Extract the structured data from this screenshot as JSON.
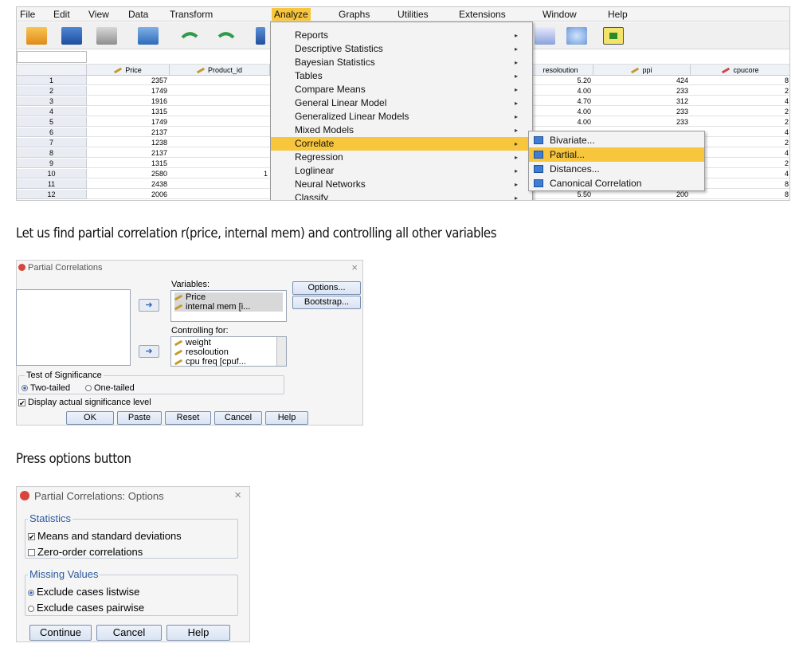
{
  "menubar": [
    "File",
    "Edit",
    "View",
    "Data",
    "Transform",
    "Analyze",
    "Graphs",
    "Utilities",
    "Extensions",
    "Window",
    "Help"
  ],
  "columns": [
    {
      "label": "Price",
      "icon": "ruler-icon"
    },
    {
      "label": "Product_id",
      "icon": "ruler-icon"
    },
    {
      "label": "resoloution",
      "icon": "ruler-icon"
    },
    {
      "label": "ppi",
      "icon": "ruler-icon"
    },
    {
      "label": "cpucore",
      "icon": "nominal-icon"
    }
  ],
  "rows": [
    {
      "n": "1",
      "price": "2357",
      "pid": "",
      "res": "5.20",
      "ppi": "424",
      "core": "8"
    },
    {
      "n": "2",
      "price": "1749",
      "pid": "",
      "res": "4.00",
      "ppi": "233",
      "core": "2"
    },
    {
      "n": "3",
      "price": "1916",
      "pid": "",
      "res": "4.70",
      "ppi": "312",
      "core": "4"
    },
    {
      "n": "4",
      "price": "1315",
      "pid": "",
      "res": "4.00",
      "ppi": "233",
      "core": "2"
    },
    {
      "n": "5",
      "price": "1749",
      "pid": "",
      "res": "4.00",
      "ppi": "233",
      "core": "2"
    },
    {
      "n": "6",
      "price": "2137",
      "pid": "",
      "res": "",
      "ppi": "",
      "core": "4"
    },
    {
      "n": "7",
      "price": "1238",
      "pid": "",
      "res": "",
      "ppi": "",
      "core": "2"
    },
    {
      "n": "8",
      "price": "2137",
      "pid": "",
      "res": "",
      "ppi": "",
      "core": "4"
    },
    {
      "n": "9",
      "price": "1315",
      "pid": "",
      "res": "",
      "ppi": "",
      "core": "2"
    },
    {
      "n": "10",
      "price": "2580",
      "pid": "1",
      "res": "",
      "ppi": "",
      "core": "4"
    },
    {
      "n": "11",
      "price": "2438",
      "pid": "",
      "res": "",
      "ppi": "",
      "core": "8"
    },
    {
      "n": "12",
      "price": "2006",
      "pid": "",
      "res": "5.50",
      "ppi": "200",
      "core": "8"
    }
  ],
  "analyze_menu": [
    "Reports",
    "Descriptive Statistics",
    "Bayesian Statistics",
    "Tables",
    "Compare Means",
    "General Linear Model",
    "Generalized Linear Models",
    "Mixed Models",
    "Correlate",
    "Regression",
    "Loglinear",
    "Neural Networks",
    "Classify"
  ],
  "correlate_submenu": [
    "Bivariate...",
    "Partial...",
    "Distances...",
    "Canonical Correlation"
  ],
  "instructions": {
    "step1": "Let us find partial correlation r(price, internal mem) and controlling all other variables",
    "step2": "Press options button"
  },
  "partial_dialog": {
    "title": "Partial Correlations",
    "variables_label": "Variables:",
    "variables": [
      "Price",
      "internal mem [i..."
    ],
    "controlling_label": "Controlling for:",
    "controlling": [
      "weight",
      "resoloution",
      "cpu freq [cpuf..."
    ],
    "options_button": "Options...",
    "bootstrap_button": "Bootstrap...",
    "significance_legend": "Test of Significance",
    "two_tailed": "Two-tailed",
    "one_tailed": "One-tailed",
    "display_sig": "Display actual significance level",
    "buttons": [
      "OK",
      "Paste",
      "Reset",
      "Cancel",
      "Help"
    ]
  },
  "options_dialog": {
    "title": "Partial Correlations: Options",
    "statistics_legend": "Statistics",
    "means_sd": "Means and standard deviations",
    "zero_order": "Zero-order correlations",
    "missing_legend": "Missing Values",
    "listwise": "Exclude cases listwise",
    "pairwise": "Exclude cases pairwise",
    "buttons": [
      "Continue",
      "Cancel",
      "Help"
    ]
  },
  "colors": {
    "highlight": "#f7c63d",
    "accent_blue": "#2b6ad4"
  }
}
